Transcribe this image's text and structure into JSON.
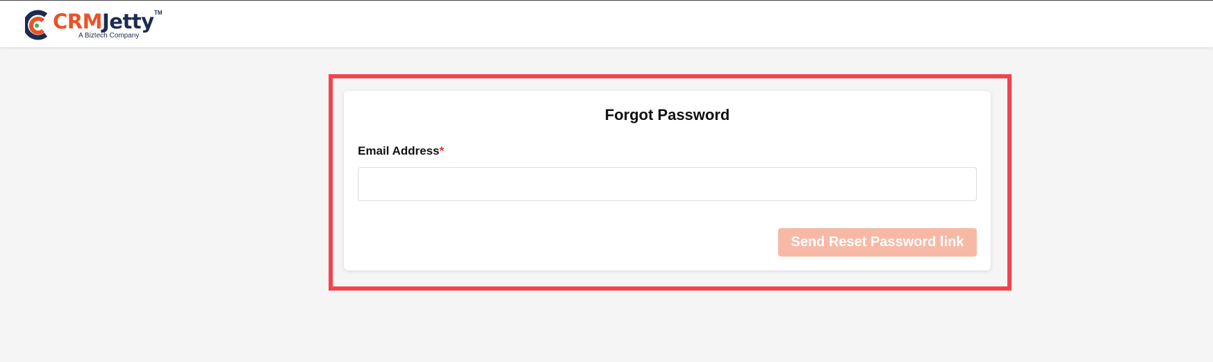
{
  "header": {
    "logo": {
      "brand_part1": "CRM",
      "brand_part2": "Jetty",
      "trademark": "TM",
      "tagline": "A Biztech Company",
      "colors": {
        "orange": "#e8542a",
        "navy": "#1c2c4e",
        "dot": "#3bb54a"
      }
    }
  },
  "form": {
    "title": "Forgot Password",
    "email_label": "Email Address",
    "required_mark": "*",
    "email_value": "",
    "email_placeholder": "",
    "submit_label": "Send Reset Password link",
    "submit_enabled": false
  },
  "colors": {
    "highlight": "#f4434b",
    "button_disabled": "#f7b9a6",
    "page_bg": "#f5f5f5"
  }
}
